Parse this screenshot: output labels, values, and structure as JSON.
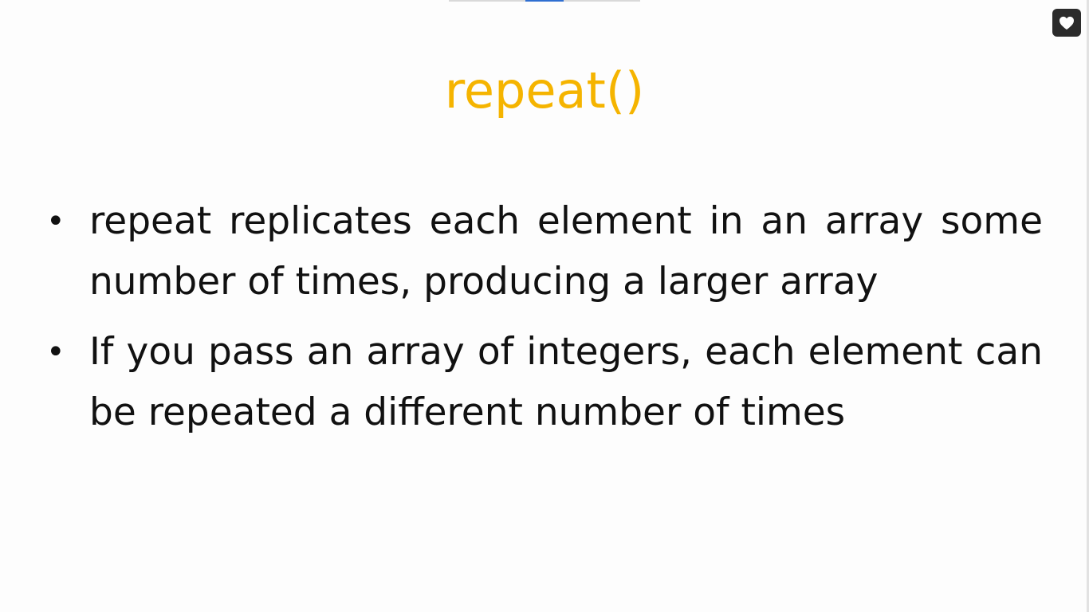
{
  "slide": {
    "title": "repeat()",
    "bullets": [
      {
        "marker": "•",
        "text": "repeat replicates each element in an array some number of times, producing a larger array"
      },
      {
        "marker": "•",
        "text": "If you pass an array of integers, each element can be repeated a different number of times"
      }
    ]
  },
  "controls": {
    "favorite_icon": "heart-icon"
  },
  "colors": {
    "title": "#f5b400",
    "body_text": "#111111",
    "background": "#fdfdfd",
    "progress_accent": "#2f6fd1",
    "favorite_bg": "#2b2b2b"
  }
}
